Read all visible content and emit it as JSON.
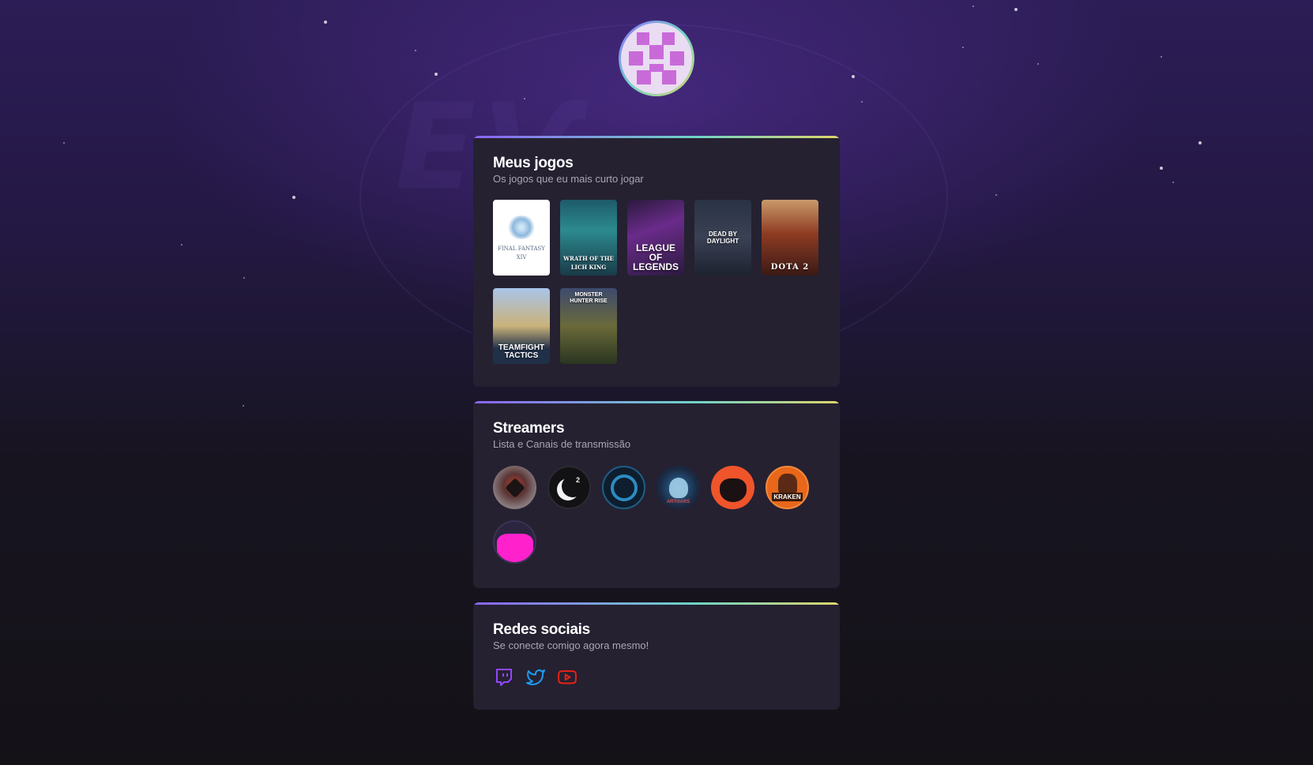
{
  "page": {
    "background_colors": [
      "#2c1d56",
      "#141217"
    ],
    "accent_gradient": [
      "#8a63f5",
      "#6fd3c7",
      "#dfd56b"
    ],
    "card_color": "#252131"
  },
  "profile": {
    "avatar_icon": "pixel-avatar-icon"
  },
  "games_section": {
    "title": "Meus jogos",
    "subtitle": "Os jogos que eu mais curto jogar",
    "games": [
      {
        "title": "FINAL FANTASY XIV"
      },
      {
        "title": "WRATH OF THE LICH KING"
      },
      {
        "title": "LEAGUE OF LEGENDS"
      },
      {
        "title": "DEAD BY DAYLIGHT"
      },
      {
        "title": "DOTA 2"
      },
      {
        "title": "TEAMFIGHT TACTICS"
      },
      {
        "title": "MONSTER HUNTER RISE"
      }
    ]
  },
  "streamers_section": {
    "title": "Streamers",
    "subtitle": "Lista e Canais de transmissão",
    "streamers": [
      {
        "icon": "red-eye-avatar-icon"
      },
      {
        "icon": "moon-avatar-icon",
        "label": "2"
      },
      {
        "icon": "blue-logo-avatar-icon"
      },
      {
        "icon": "skull-avatar-icon",
        "label": "ARTHARS"
      },
      {
        "icon": "black-cat-avatar-icon"
      },
      {
        "icon": "kraken-avatar-icon",
        "label": "KRAKEN"
      },
      {
        "icon": "pink-cat-avatar-icon"
      }
    ]
  },
  "social_section": {
    "title": "Redes sociais",
    "subtitle": "Se conecte comigo agora mesmo!",
    "links": [
      {
        "icon": "twitch-icon",
        "color": "#9146ff"
      },
      {
        "icon": "twitter-icon",
        "color": "#1d9bf0"
      },
      {
        "icon": "youtube-icon",
        "color": "#e62117"
      }
    ]
  }
}
